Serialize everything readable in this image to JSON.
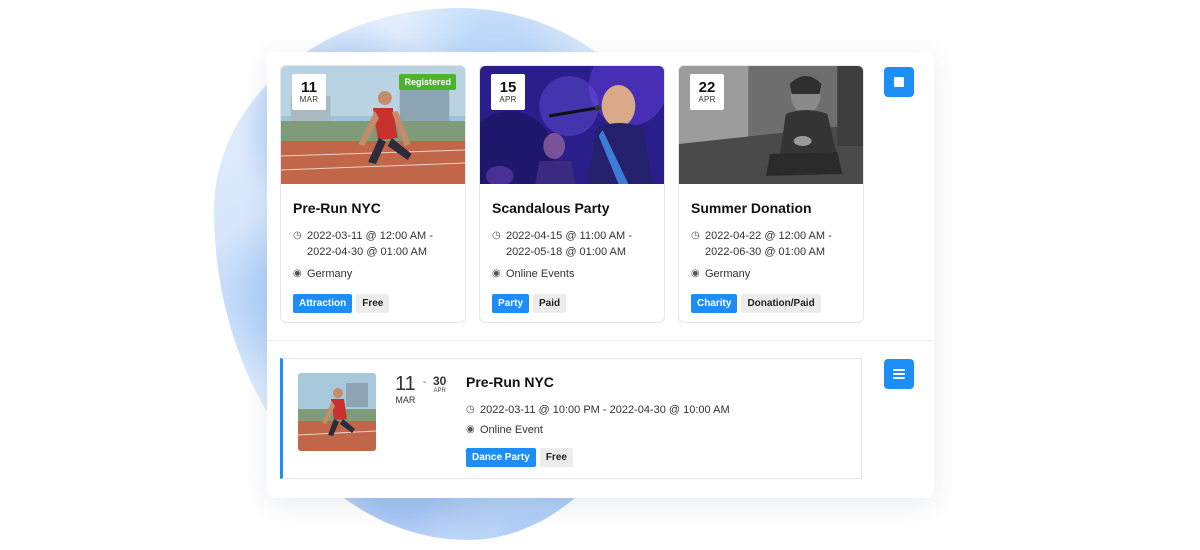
{
  "colors": {
    "accent": "#1d8ef5",
    "registered": "#49b42c",
    "tag_grey": "#ececec"
  },
  "view_toggle": {
    "grid_icon": "grid-view-icon",
    "list_icon": "list-view-icon"
  },
  "cards": [
    {
      "day": "11",
      "month": "MAR",
      "badge": "Registered",
      "title": "Pre-Run NYC",
      "time_line1": "2022-03-11 @ 12:00 AM -",
      "time_line2": "2022-04-30 @ 01:00 AM",
      "location": "Germany",
      "tag_primary": "Attraction",
      "tag_secondary": "Free",
      "image": "runner-starting-block-photo"
    },
    {
      "day": "15",
      "month": "APR",
      "title": "Scandalous Party",
      "time_line1": "2022-04-15 @ 11:00 AM -",
      "time_line2": "2022-05-18 @ 01:00 AM",
      "location": "Online Events",
      "tag_primary": "Party",
      "tag_secondary": "Paid",
      "image": "concert-singer-photo"
    },
    {
      "day": "22",
      "month": "APR",
      "title": "Summer Donation",
      "time_line1": "2022-04-22 @ 12:00 AM -",
      "time_line2": "2022-06-30 @ 01:00 AM",
      "location": "Germany",
      "tag_primary": "Charity",
      "tag_secondary": "Donation/Paid",
      "image": "elderly-man-sitting-photo"
    }
  ],
  "list_event": {
    "start_day": "11",
    "start_month": "MAR",
    "separator": "-",
    "end_day": "30",
    "end_month": "APR",
    "title": "Pre-Run NYC",
    "time": "2022-03-11 @ 10:00 PM - 2022-04-30 @ 10:00 AM",
    "location": "Online Event",
    "tag_primary": "Dance Party",
    "tag_secondary": "Free",
    "image": "runner-starting-block-photo"
  }
}
